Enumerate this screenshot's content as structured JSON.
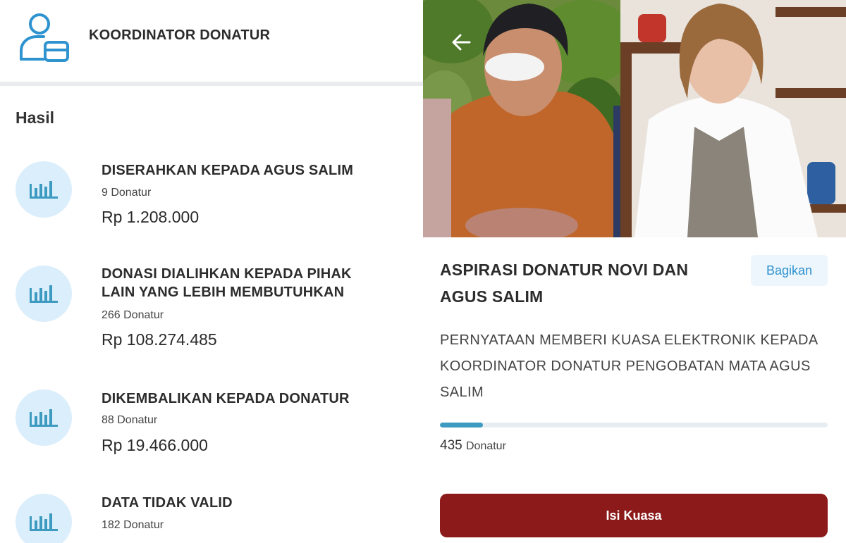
{
  "coordinator": {
    "title": "KOORDINATOR DONATUR",
    "icon": "user-card-icon"
  },
  "results": {
    "heading": "Hasil",
    "items": [
      {
        "title": "DISERAHKAN KEPADA AGUS SALIM",
        "count": "9 Donatur",
        "amount": "Rp 1.208.000",
        "icon": "bar-chart-icon"
      },
      {
        "title": "DONASI DIALIHKAN KEPADA PIHAK LAIN YANG LEBIH MEMBUTUHKAN",
        "count": "266 Donatur",
        "amount": "Rp 108.274.485",
        "icon": "bar-chart-icon"
      },
      {
        "title": "DIKEMBALIKAN KEPADA DONATUR",
        "count": "88 Donatur",
        "amount": "Rp 19.466.000",
        "icon": "bar-chart-icon"
      },
      {
        "title": "DATA TIDAK VALID",
        "count": "182 Donatur",
        "icon": "bar-chart-icon"
      }
    ]
  },
  "campaign": {
    "title": "ASPIRASI DONATUR NOVI DAN AGUS SALIM",
    "share_label": "Bagikan",
    "description": "PERNYATAAN MEMBERI KUASA ELEKTRONIK KEPADA KOORDINATOR DONATUR PENGOBATAN MATA AGUS SALIM",
    "progress_percent": 11,
    "donor_count": "435",
    "donor_unit": "Donatur",
    "action_label": "Isi Kuasa"
  },
  "colors": {
    "accent_blue": "#2f93cf",
    "icon_circle": "#dbeefb",
    "progress": "#3d9ac1",
    "action": "#8c1a1a"
  }
}
